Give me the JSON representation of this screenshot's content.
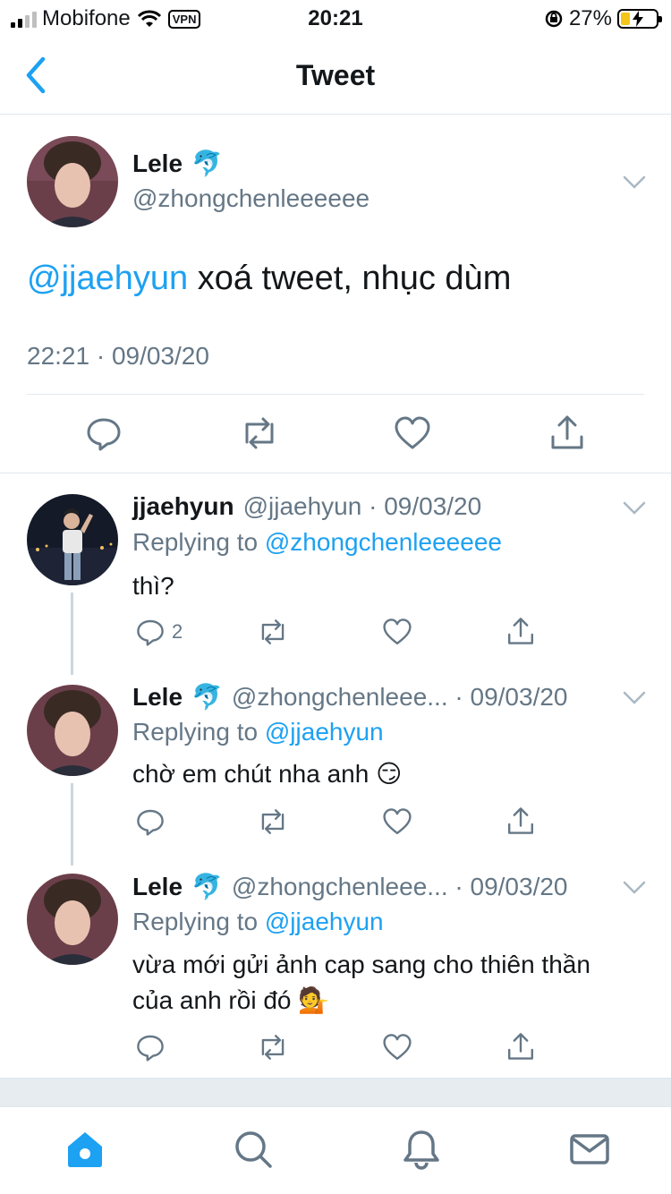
{
  "status_bar": {
    "carrier": "Mobifone",
    "vpn": "VPN",
    "time": "20:21",
    "battery": "27%",
    "battery_level": 0.27
  },
  "nav": {
    "title": "Tweet"
  },
  "main_tweet": {
    "name": "Lele",
    "emoji": "🐬",
    "handle": "@zhongchenleeeeee",
    "mention": "@jjaehyun",
    "text": " xoá tweet, nhục dùm",
    "timestamp": "22:21 · 09/03/20"
  },
  "replies": [
    {
      "name": "jjaehyun",
      "emoji": "",
      "meta": "@jjaehyun · 09/03/20",
      "replying_prefix": "Replying to ",
      "replying_to": "@zhongchenleeeeee",
      "text": "thì?",
      "reply_count": "2"
    },
    {
      "name": "Lele",
      "emoji": "🐬",
      "meta": "@zhongchenleee... · 09/03/20",
      "replying_prefix": "Replying to ",
      "replying_to": "@jjaehyun",
      "text": "chờ em chút nha anh 😏",
      "reply_count": ""
    },
    {
      "name": "Lele",
      "emoji": "🐬",
      "meta": "@zhongchenleee... · 09/03/20",
      "replying_prefix": "Replying to ",
      "replying_to": "@jjaehyun",
      "text_line1": "vừa mới gửi ảnh cap sang cho thiên thần",
      "text_line2": "của anh rồi đó 💁",
      "reply_count": ""
    }
  ],
  "colors": {
    "accent": "#1da1f2",
    "muted": "#657786",
    "divider": "#e1e8ed"
  },
  "icons": [
    "back-chevron-icon",
    "reply-icon",
    "retweet-icon",
    "like-icon",
    "share-icon",
    "home-icon",
    "search-icon",
    "notifications-icon",
    "messages-icon"
  ]
}
